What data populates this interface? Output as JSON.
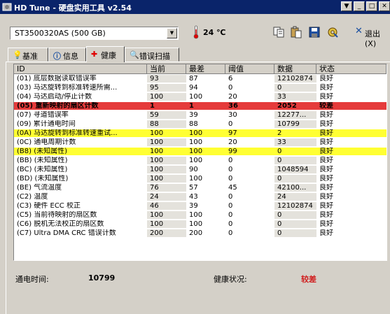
{
  "window": {
    "title": "HD Tune - 硬盘实用工具 v2.54"
  },
  "toolbar": {
    "drive": "ST3500320AS (500 GB)",
    "temperature": "24 ℃",
    "exit_label": "退出(X)"
  },
  "tabs": [
    {
      "label": "基准",
      "icon": "lightbulb-icon"
    },
    {
      "label": "信息",
      "icon": "info-icon"
    },
    {
      "label": "健康",
      "icon": "red-cross-icon",
      "active": true
    },
    {
      "label": "错误扫描",
      "icon": "magnifier-icon"
    }
  ],
  "table": {
    "headers": [
      "ID",
      "当前",
      "最差",
      "阈值",
      "数据",
      "状态"
    ],
    "rows": [
      {
        "id": "(01) 底层数据读取错误率",
        "cur": "93",
        "worst": "87",
        "thr": "6",
        "data": "12102874",
        "status": "良好",
        "hl": ""
      },
      {
        "id": "(03) 马达旋转到标准转速所需...",
        "cur": "95",
        "worst": "94",
        "thr": "0",
        "data": "0",
        "status": "良好",
        "hl": ""
      },
      {
        "id": "(04) 马达启动/停止计数",
        "cur": "100",
        "worst": "100",
        "thr": "20",
        "data": "33",
        "status": "良好",
        "hl": ""
      },
      {
        "id": "(05) 重新映射的扇区计数",
        "cur": "1",
        "worst": "1",
        "thr": "36",
        "data": "2052",
        "status": "较差",
        "hl": "red"
      },
      {
        "id": "(07) 寻道错误率",
        "cur": "59",
        "worst": "39",
        "thr": "30",
        "data": "12277...",
        "status": "良好",
        "hl": ""
      },
      {
        "id": "(09) 累计通电时间",
        "cur": "88",
        "worst": "88",
        "thr": "0",
        "data": "10799",
        "status": "良好",
        "hl": ""
      },
      {
        "id": "(0A) 马达旋转到标准转速重试...",
        "cur": "100",
        "worst": "100",
        "thr": "97",
        "data": "2",
        "status": "良好",
        "hl": "yellow"
      },
      {
        "id": "(0C) 通电周期计数",
        "cur": "100",
        "worst": "100",
        "thr": "20",
        "data": "33",
        "status": "良好",
        "hl": ""
      },
      {
        "id": "(B8) (未知属性)",
        "cur": "100",
        "worst": "100",
        "thr": "99",
        "data": "0",
        "status": "良好",
        "hl": "yellow"
      },
      {
        "id": "(BB) (未知属性)",
        "cur": "100",
        "worst": "100",
        "thr": "0",
        "data": "0",
        "status": "良好",
        "hl": ""
      },
      {
        "id": "(BC) (未知属性)",
        "cur": "100",
        "worst": "90",
        "thr": "0",
        "data": "1048594",
        "status": "良好",
        "hl": ""
      },
      {
        "id": "(BD) (未知属性)",
        "cur": "100",
        "worst": "100",
        "thr": "0",
        "data": "0",
        "status": "良好",
        "hl": ""
      },
      {
        "id": "(BE) 气流温度",
        "cur": "76",
        "worst": "57",
        "thr": "45",
        "data": "42100...",
        "status": "良好",
        "hl": ""
      },
      {
        "id": "(C2) 温度",
        "cur": "24",
        "worst": "43",
        "thr": "0",
        "data": "24",
        "status": "良好",
        "hl": ""
      },
      {
        "id": "(C3) 硬件 ECC 校正",
        "cur": "46",
        "worst": "39",
        "thr": "0",
        "data": "12102874",
        "status": "良好",
        "hl": ""
      },
      {
        "id": "(C5) 当前待映射的扇区数",
        "cur": "100",
        "worst": "100",
        "thr": "0",
        "data": "0",
        "status": "良好",
        "hl": ""
      },
      {
        "id": "(C6) 脱机无法校正的扇区数",
        "cur": "100",
        "worst": "100",
        "thr": "0",
        "data": "0",
        "status": "良好",
        "hl": ""
      },
      {
        "id": "(C7) Ultra DMA CRC 错误计数",
        "cur": "200",
        "worst": "200",
        "thr": "0",
        "data": "0",
        "status": "良好",
        "hl": ""
      }
    ]
  },
  "status_bar": {
    "power_on_label": "通电时间:",
    "power_on_value": "10799",
    "health_label": "健康状况:",
    "health_value": "较差"
  },
  "colors": {
    "bad_row": "#e53b3b",
    "warn_row": "#ffff33",
    "bad_text": "#d02020",
    "titlebar": "#0a246a"
  }
}
